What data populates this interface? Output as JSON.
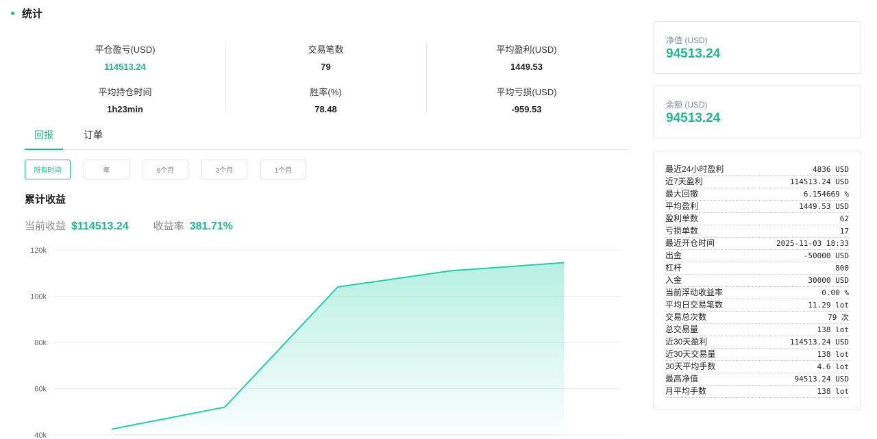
{
  "section_title": "统计",
  "stats": [
    {
      "label": "平仓盈亏(USD)",
      "value": "114513.24",
      "green": true
    },
    {
      "label": "交易笔数",
      "value": "79"
    },
    {
      "label": "平均盈利(USD)",
      "value": "1449.53"
    },
    {
      "label": "平均持仓时间",
      "value": "1h23min"
    },
    {
      "label": "胜率(%)",
      "value": "78.48"
    },
    {
      "label": "平均亏损(USD)",
      "value": "-959.53"
    }
  ],
  "tabs": [
    "回报",
    "订单"
  ],
  "range_buttons": [
    "所有时间",
    "年",
    "6个月",
    "3个月",
    "1个月"
  ],
  "chart_title": "累计收益",
  "summary": {
    "current_label": "当前收益",
    "current_value": "$114513.24",
    "rate_label": "收益率",
    "rate_value": "381.71%"
  },
  "chart_data": {
    "type": "area",
    "title": "累计收益",
    "x": [
      1,
      2,
      3,
      4,
      5
    ],
    "values": [
      42500,
      52000,
      104000,
      111000,
      114513.24
    ],
    "ylim": [
      40000,
      120000
    ],
    "yticks": [
      40000,
      60000,
      80000,
      100000,
      120000
    ],
    "ytick_labels": [
      "40k",
      "60k",
      "80k",
      "100k",
      "120k"
    ],
    "grid": true,
    "color": "#1fcfa6"
  },
  "cards": [
    {
      "label": "净值 (USD)",
      "value": "94513.24"
    },
    {
      "label": "余额 (USD)",
      "value": "94513.24"
    }
  ],
  "details": [
    {
      "label": "最近24小时盈利",
      "value": "4836 USD"
    },
    {
      "label": "近7天盈利",
      "value": "114513.24 USD"
    },
    {
      "label": "最大回撤",
      "value": "6.154669 %"
    },
    {
      "label": "平均盈利",
      "value": "1449.53 USD"
    },
    {
      "label": "盈利单数",
      "value": "62"
    },
    {
      "label": "亏损单数",
      "value": "17"
    },
    {
      "label": "最近开仓时间",
      "value": "2025-11-03 18:33"
    },
    {
      "label": "出金",
      "value": "-50000 USD"
    },
    {
      "label": "杠杆",
      "value": "800"
    },
    {
      "label": "入金",
      "value": "30000 USD"
    },
    {
      "label": "当前浮动收益率",
      "value": "0.00 %"
    },
    {
      "label": "平均日交易笔数",
      "value": "11.29 lot"
    },
    {
      "label": "交易总次数",
      "value": "79 次"
    },
    {
      "label": "总交易量",
      "value": "138 lot"
    },
    {
      "label": "近30天盈利",
      "value": "114513.24 USD"
    },
    {
      "label": "近30天交易量",
      "value": "138 lot"
    },
    {
      "label": "30天平均手数",
      "value": "4.6 lot"
    },
    {
      "label": "最高净值",
      "value": "94513.24 USD"
    },
    {
      "label": "月平均手数",
      "value": "138 lot"
    }
  ],
  "colors": {
    "accent": "#1fb98b",
    "chart_line": "#1fcfa6",
    "border": "#e6e6e6"
  }
}
